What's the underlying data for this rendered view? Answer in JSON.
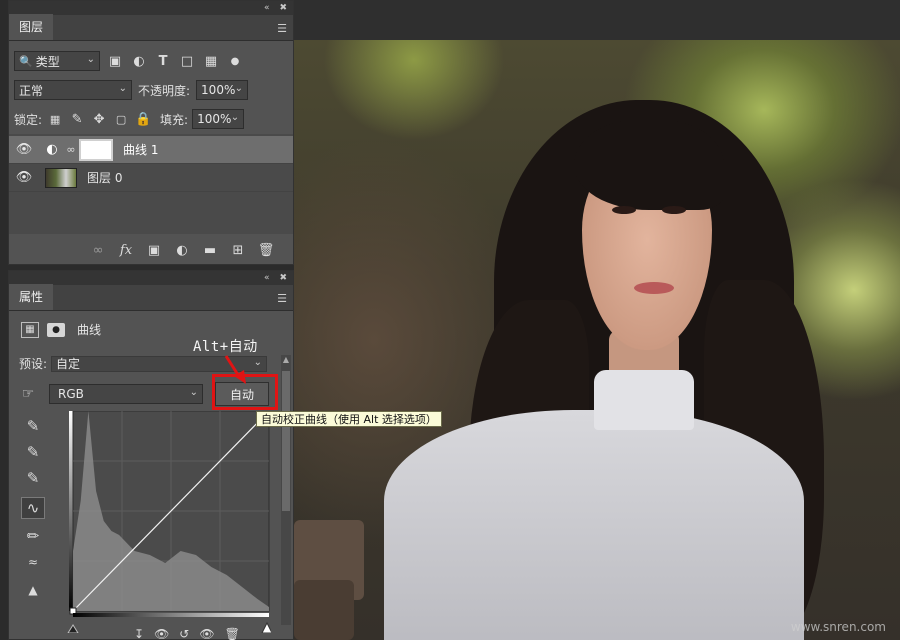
{
  "layers_panel": {
    "tab": "图层",
    "filter_kind": "类型",
    "blend_mode": "正常",
    "opacity_label": "不透明度:",
    "opacity_value": "100%",
    "lock_label": "锁定:",
    "fill_label": "填充:",
    "fill_value": "100%",
    "layers": [
      {
        "name": "曲线 1",
        "kind": "adjustment",
        "visible": true,
        "selected": true
      },
      {
        "name": "图层 0",
        "kind": "pixel",
        "visible": true,
        "selected": false
      }
    ],
    "footer_icons": [
      "link-icon",
      "fx-icon",
      "mask-icon",
      "adjustment-icon",
      "folder-icon",
      "new-layer-icon",
      "trash-icon"
    ]
  },
  "properties_panel": {
    "tab": "属性",
    "adjustment_title": "曲线",
    "preset_label": "预设:",
    "preset_value": "自定",
    "channel_value": "RGB",
    "auto_button": "自动",
    "tooltip": "自动校正曲线（使用 Alt 选择选项）",
    "left_tools": [
      "sample-black-icon",
      "sample-gray-icon",
      "sample-white-icon",
      "curve-edit-icon",
      "pencil-icon",
      "smooth-icon",
      "clipping-warning-icon"
    ]
  },
  "annotation": {
    "label": "Alt+自动",
    "accent_color": "#e01414"
  },
  "watermark": "www.snren.com",
  "chart_data": {
    "type": "area",
    "x": [
      0,
      10,
      20,
      25,
      30,
      40,
      50,
      60,
      80,
      100,
      120,
      140,
      160,
      180,
      200,
      220,
      240,
      255
    ],
    "values": [
      30,
      55,
      100,
      80,
      60,
      45,
      40,
      38,
      30,
      28,
      24,
      30,
      28,
      22,
      18,
      12,
      6,
      2
    ],
    "curve": [
      [
        0,
        0
      ],
      [
        255,
        255
      ]
    ],
    "xlim": [
      0,
      255
    ],
    "ylim": [
      0,
      100
    ],
    "grid": true
  }
}
